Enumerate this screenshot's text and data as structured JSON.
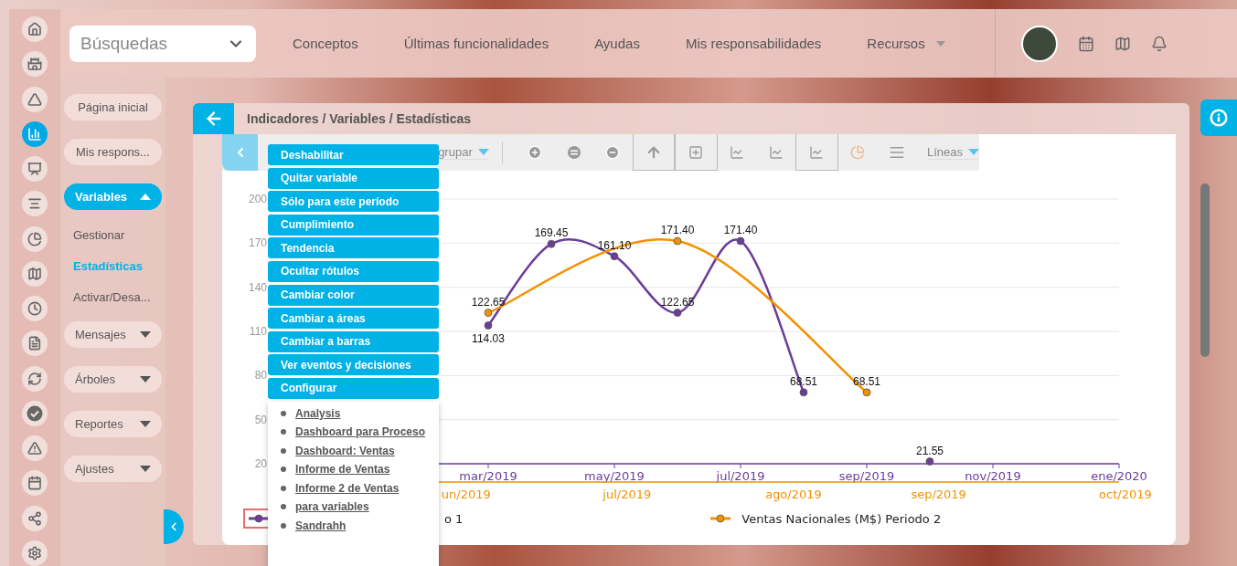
{
  "icon_rail": {
    "items": [
      {
        "selected": false
      },
      {
        "selected": false
      },
      {
        "selected": false
      },
      {
        "selected": true
      },
      {
        "selected": false
      },
      {
        "selected": false
      },
      {
        "selected": false
      },
      {
        "selected": false
      },
      {
        "selected": false
      },
      {
        "selected": false
      },
      {
        "selected": false
      },
      {
        "selected": false
      },
      {
        "selected": false
      },
      {
        "selected": false
      },
      {
        "selected": false
      },
      {
        "selected": false
      }
    ]
  },
  "top_bar": {
    "search": {
      "value": "Búsquedas"
    },
    "nav": [
      "Conceptos",
      "Últimas funcionalidades",
      "Ayudas",
      "Mis responsabilidades",
      "Recursos"
    ]
  },
  "nav_panel": {
    "items": [
      {
        "kind": "pill",
        "label": "Página inicial"
      },
      {
        "kind": "pill",
        "label": "Mis respons..."
      },
      {
        "kind": "group",
        "label": "Variables",
        "expanded": true,
        "children": [
          {
            "label": "Gestionar",
            "selected": false
          },
          {
            "label": "Estadísticas",
            "selected": true
          },
          {
            "label": "Activar/Desa...",
            "selected": false
          }
        ]
      },
      {
        "kind": "group",
        "label": "Mensajes",
        "expanded": false
      },
      {
        "kind": "group",
        "label": "Árboles",
        "expanded": false
      },
      {
        "kind": "group",
        "label": "Reportes",
        "expanded": false
      },
      {
        "kind": "group",
        "label": "Ajustes",
        "expanded": false
      }
    ]
  },
  "page": {
    "breadcrumb": "Indicadores / Variables / Estadísticas",
    "toolbar": {
      "group_label": "grupar",
      "chart_type": "Líneas"
    },
    "chart": {
      "chart_data": {
        "type": "line",
        "categories": [
          null,
          null,
          null,
          "mar/2019",
          null,
          "may/2019",
          null,
          "jul/2019",
          null,
          "sep/2019",
          null,
          "nov/2019",
          null,
          "ene/2020"
        ],
        "ylim": [
          20,
          200
        ],
        "grid": true,
        "yticks": [
          20,
          50,
          80,
          110,
          140,
          170,
          200
        ],
        "series": [
          {
            "color": "#6a3d9a",
            "marker": "circle",
            "values": [
              null,
              null,
              null,
              114.03,
              169.45,
              161.1,
              122.65,
              171.4,
              68.51,
              null,
              21.55,
              null,
              null,
              null
            ],
            "value_labels": [
              null,
              null,
              null,
              "114.03",
              "169.45",
              "161.10",
              "122.65",
              "171.40",
              "68.51",
              null,
              "21.55",
              null,
              null,
              null
            ]
          },
          {
            "color": "#f39200",
            "marker": "circle",
            "values": [
              null,
              null,
              null,
              122.65,
              null,
              null,
              171.4,
              null,
              null,
              68.51,
              null,
              null,
              null,
              null
            ],
            "value_labels": [
              null,
              null,
              null,
              "122.65",
              null,
              null,
              "171.40",
              null,
              null,
              "68.51",
              null,
              null,
              null,
              null
            ]
          }
        ]
      },
      "gaps_joined": [
        false,
        true
      ],
      "secondary_x_labels": [
        "un/2019",
        "jul/2019",
        "ago/2019",
        "sep/2019",
        "oct/2019"
      ],
      "legend": [
        {
          "label": "o 1",
          "selected": true
        },
        {
          "label": "Ventas Nacionales (M$) Periodo 2",
          "selected": false
        }
      ]
    },
    "context_menu": {
      "actions": [
        "Deshabilitar",
        "Quitar variable",
        "Sólo para este período",
        "Cumplimiento",
        "Tendencia",
        "Ocultar rótulos",
        "Cambiar color",
        "Cambiar a áreas",
        "Cambiar a barras",
        "Ver eventos y decisiones",
        "Configurar"
      ],
      "links": [
        "Analysis",
        "Dashboard para Proceso",
        "Dashboard: Ventas",
        "Informe de Ventas",
        "Informe 2 de Ventas",
        "para variables",
        "Sandrahh"
      ]
    }
  }
}
